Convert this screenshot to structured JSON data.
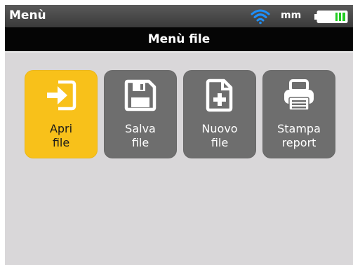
{
  "statusbar": {
    "title": "Menù",
    "unit": "mm",
    "wifi_icon": "wifi-icon",
    "battery_icon": "battery-icon",
    "battery_color": "#22cc22"
  },
  "header": {
    "title": "Menù file"
  },
  "tiles": [
    {
      "line1": "Apri",
      "line2": "file",
      "icon": "open-file-icon",
      "selected": true
    },
    {
      "line1": "Salva",
      "line2": "file",
      "icon": "save-icon",
      "selected": false
    },
    {
      "line1": "Nuovo",
      "line2": "file",
      "icon": "new-file-icon",
      "selected": false
    },
    {
      "line1": "Stampa",
      "line2": "report",
      "icon": "printer-icon",
      "selected": false
    }
  ],
  "colors": {
    "accent": "#f8c11a",
    "tile": "#6e6e6e",
    "background": "#d9d7d9",
    "wifi": "#1e90ff"
  }
}
